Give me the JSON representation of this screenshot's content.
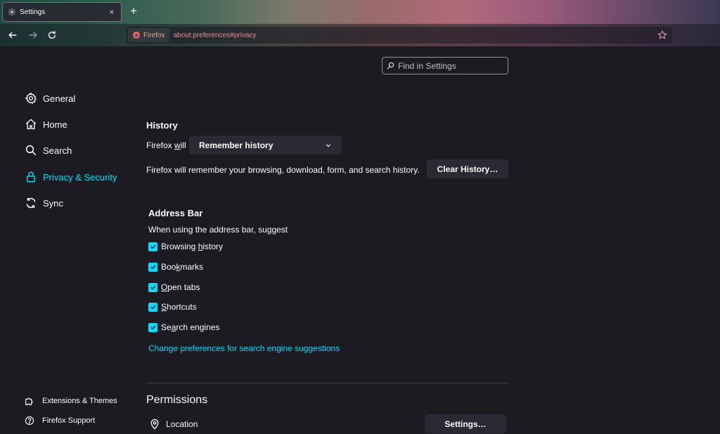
{
  "tab": {
    "title": "Settings",
    "close": "×",
    "icon": "gear-icon"
  },
  "newtab": {
    "label": "+"
  },
  "nav": {
    "back_icon": "arrow-left-icon",
    "forward_icon": "arrow-right-icon",
    "reload_icon": "reload-icon"
  },
  "urlbar": {
    "identity_label": "Firefox",
    "url": "about:preferences#privacy",
    "bookmark_icon": "star-icon"
  },
  "search": {
    "placeholder": "Find in Settings",
    "value": ""
  },
  "sidebar": {
    "items": [
      {
        "label": "General",
        "icon": "gear-icon"
      },
      {
        "label": "Home",
        "icon": "home-icon"
      },
      {
        "label": "Search",
        "icon": "search-icon"
      },
      {
        "label": "Privacy & Security",
        "icon": "lock-icon",
        "active": true
      },
      {
        "label": "Sync",
        "icon": "sync-icon"
      }
    ],
    "footer": [
      {
        "label": "Extensions & Themes",
        "icon": "puzzle-icon"
      },
      {
        "label": "Firefox Support",
        "icon": "help-icon"
      }
    ]
  },
  "history": {
    "heading": "History",
    "firefox_will_prefix": "Firefox ",
    "firefox_will_accel": "w",
    "firefox_will_suffix": "ill",
    "select_value": "Remember history",
    "description": "Firefox will remember your browsing, download, form, and search history.",
    "clear_button": "Clear History…"
  },
  "address_bar": {
    "heading": "Address Bar",
    "subheading": "When using the address bar, suggest",
    "options": [
      {
        "pre": "Browsing ",
        "accel": "h",
        "post": "istory",
        "checked": true
      },
      {
        "pre": "Boo",
        "accel": "k",
        "post": "marks",
        "checked": true
      },
      {
        "pre": "",
        "accel": "O",
        "post": "pen tabs",
        "checked": true
      },
      {
        "pre": "",
        "accel": "S",
        "post": "hortcuts",
        "checked": true
      },
      {
        "pre": "Se",
        "accel": "a",
        "post": "rch engines",
        "checked": true
      }
    ],
    "link": "Change preferences for search engine suggestions"
  },
  "permissions": {
    "heading": "Permissions",
    "location_label": "Location",
    "location_icon": "location-pin-icon",
    "settings_button": "Settings…"
  },
  "colors": {
    "accent": "#00ddff",
    "background": "#1c1b22",
    "button": "#2b2a33"
  }
}
